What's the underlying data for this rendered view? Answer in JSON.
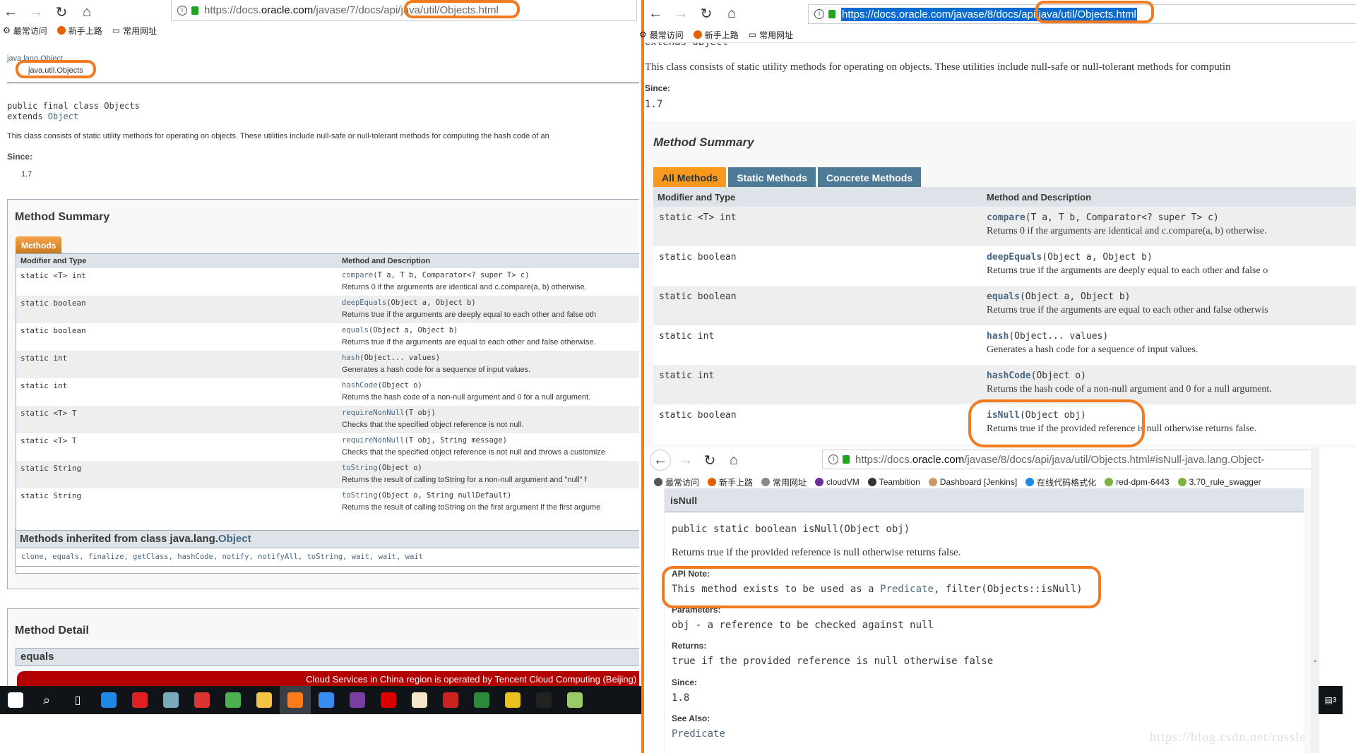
{
  "left_browser": {
    "url_prefix": "https://docs.",
    "url_domain": "oracle.com",
    "url_path": "/javase/7/docs/api/",
    "url_highlight": "java/util/Objects.html",
    "bookmarks": [
      "最常访问",
      "新手上路",
      "常用网址"
    ],
    "breadcrumb_parent": "java.lang.Object",
    "breadcrumb_current": "java.util.Objects",
    "class_decl": "public final class Objects",
    "extends_kw": "extends ",
    "extends_link": "Object",
    "description": "This class consists of static utility methods for operating on objects. These utilities include null-safe or null-tolerant methods for computing the hash code of an",
    "since_label": "Since:",
    "since_value": "1.7",
    "summary_title": "Method Summary",
    "tab_label": "Methods",
    "col_modifier": "Modifier and Type",
    "col_method": "Method and Description",
    "rows": [
      {
        "type": "static <T> int",
        "name": "compare",
        "params": "(T a, T b, Comparator<? super T> c)",
        "desc": "Returns 0 if the arguments are identical and c.compare(a, b) otherwise."
      },
      {
        "type": "static boolean",
        "name": "deepEquals",
        "params": "(Object a, Object b)",
        "desc": "Returns true if the arguments are deeply equal to each other and false oth"
      },
      {
        "type": "static boolean",
        "name": "equals",
        "params": "(Object a, Object b)",
        "desc": "Returns true if the arguments are equal to each other and false otherwise."
      },
      {
        "type": "static int",
        "name": "hash",
        "params": "(Object... values)",
        "desc": "Generates a hash code for a sequence of input values."
      },
      {
        "type": "static int",
        "name": "hashCode",
        "params": "(Object o)",
        "desc": "Returns the hash code of a non-null argument and 0 for a null argument."
      },
      {
        "type": "static <T> T",
        "name": "requireNonNull",
        "params": "(T obj)",
        "desc": "Checks that the specified object reference is not null."
      },
      {
        "type": "static <T> T",
        "name": "requireNonNull",
        "params": "(T obj, String message)",
        "desc": "Checks that the specified object reference is not null and throws a customize"
      },
      {
        "type": "static String",
        "name": "toString",
        "params": "(Object o)",
        "desc": "Returns the result of calling toString for a non-null argument and \"null\" f"
      },
      {
        "type": "static String",
        "name": "toString",
        "params": "(Object o, String nullDefault)",
        "desc": "Returns the result of calling toString on the first argument if the first argume"
      }
    ],
    "inherited_title": "Methods inherited from class java.lang.",
    "inherited_link": "Object",
    "inherited_methods": "clone, equals, finalize, getClass, hashCode, notify, notifyAll, toString, wait, wait, wait",
    "detail_title": "Method Detail",
    "detail_first": "equals",
    "banner": "Cloud Services in China region is operated by Tencent Cloud Computing (Beijing) L"
  },
  "right_browser": {
    "url_main": "https://docs.oracle.com/javase/8/docs/api/java/util/Objects.html",
    "bookmarks": [
      "最常访问",
      "新手上路",
      "常用网址"
    ],
    "extends_cut": "extends Object",
    "description": "This class consists of static utility methods for operating on objects. These utilities include null-safe or null-tolerant methods for computin",
    "since_label": "Since:",
    "since_value": "1.7",
    "summary_title": "Method Summary",
    "tabs": [
      "All Methods",
      "Static Methods",
      "Concrete Methods"
    ],
    "col_modifier": "Modifier and Type",
    "col_method": "Method and Description",
    "rows": [
      {
        "type": "static <T> int",
        "name": "compare",
        "params": "(T a, T b, Comparator<? super T> c)",
        "desc": "Returns 0 if the arguments are identical and c.compare(a, b) otherwise."
      },
      {
        "type": "static boolean",
        "name": "deepEquals",
        "params": "(Object a, Object b)",
        "desc": "Returns true if the arguments are deeply equal to each other and false o"
      },
      {
        "type": "static boolean",
        "name": "equals",
        "params": "(Object a, Object b)",
        "desc": "Returns true if the arguments are equal to each other and false otherwis"
      },
      {
        "type": "static int",
        "name": "hash",
        "params": "(Object... values)",
        "desc": "Generates a hash code for a sequence of input values."
      },
      {
        "type": "static int",
        "name": "hashCode",
        "params": "(Object o)",
        "desc": "Returns the hash code of a non-null argument and 0 for a null argument."
      },
      {
        "type": "static boolean",
        "name": "isNull",
        "params": "(Object obj)",
        "desc": "Returns true if the provided reference is null otherwise returns false."
      }
    ]
  },
  "detail_browser": {
    "url_prefix": "https://docs.",
    "url_domain": "oracle.com",
    "url_path": "/javase/8/docs/api/java/util/Objects.html#isNull-java.lang.Object-",
    "bookmarks": [
      "最常访问",
      "新手上路",
      "常用网址",
      "cloudVM",
      "Teambition",
      "Dashboard [Jenkins]",
      "在线代码格式化",
      "red-dpm-6443",
      "3.70_rule_swagger"
    ],
    "method_header": "isNull",
    "signature": "public static boolean isNull(Object obj)",
    "summary": "Returns true if the provided reference is null otherwise returns false.",
    "api_note_label": "API Note:",
    "api_note_pre": "This method exists to be used as a ",
    "api_note_link": "Predicate",
    "api_note_post": ", filter(Objects::isNull)",
    "params_label": "Parameters:",
    "params_value": "obj - a reference to be checked against null",
    "returns_label": "Returns:",
    "returns_value": "true if the provided reference is null otherwise false",
    "since_label": "Since:",
    "since_value": "1.8",
    "see_also_label": "See Also:",
    "see_also_link": "Predicate"
  },
  "taskbar": {
    "icons": [
      "windows-start",
      "search",
      "task-view",
      "edge",
      "youdao",
      "paint",
      "snail",
      "chrome",
      "file-explorer",
      "firefox",
      "feishu",
      "intellij",
      "acrobat",
      "java",
      "redis",
      "rocket",
      "mf",
      "cmd",
      "notepad"
    ],
    "notification_count": "3"
  },
  "watermark": "https://blog.csdn.net/russle",
  "colors": {
    "annotation": "#f47a20",
    "tab_active": "#f8981d",
    "tab_inactive": "#4d7a97",
    "link": "#4a6782",
    "header_bg": "#dee3e9",
    "banner": "#b30000"
  }
}
